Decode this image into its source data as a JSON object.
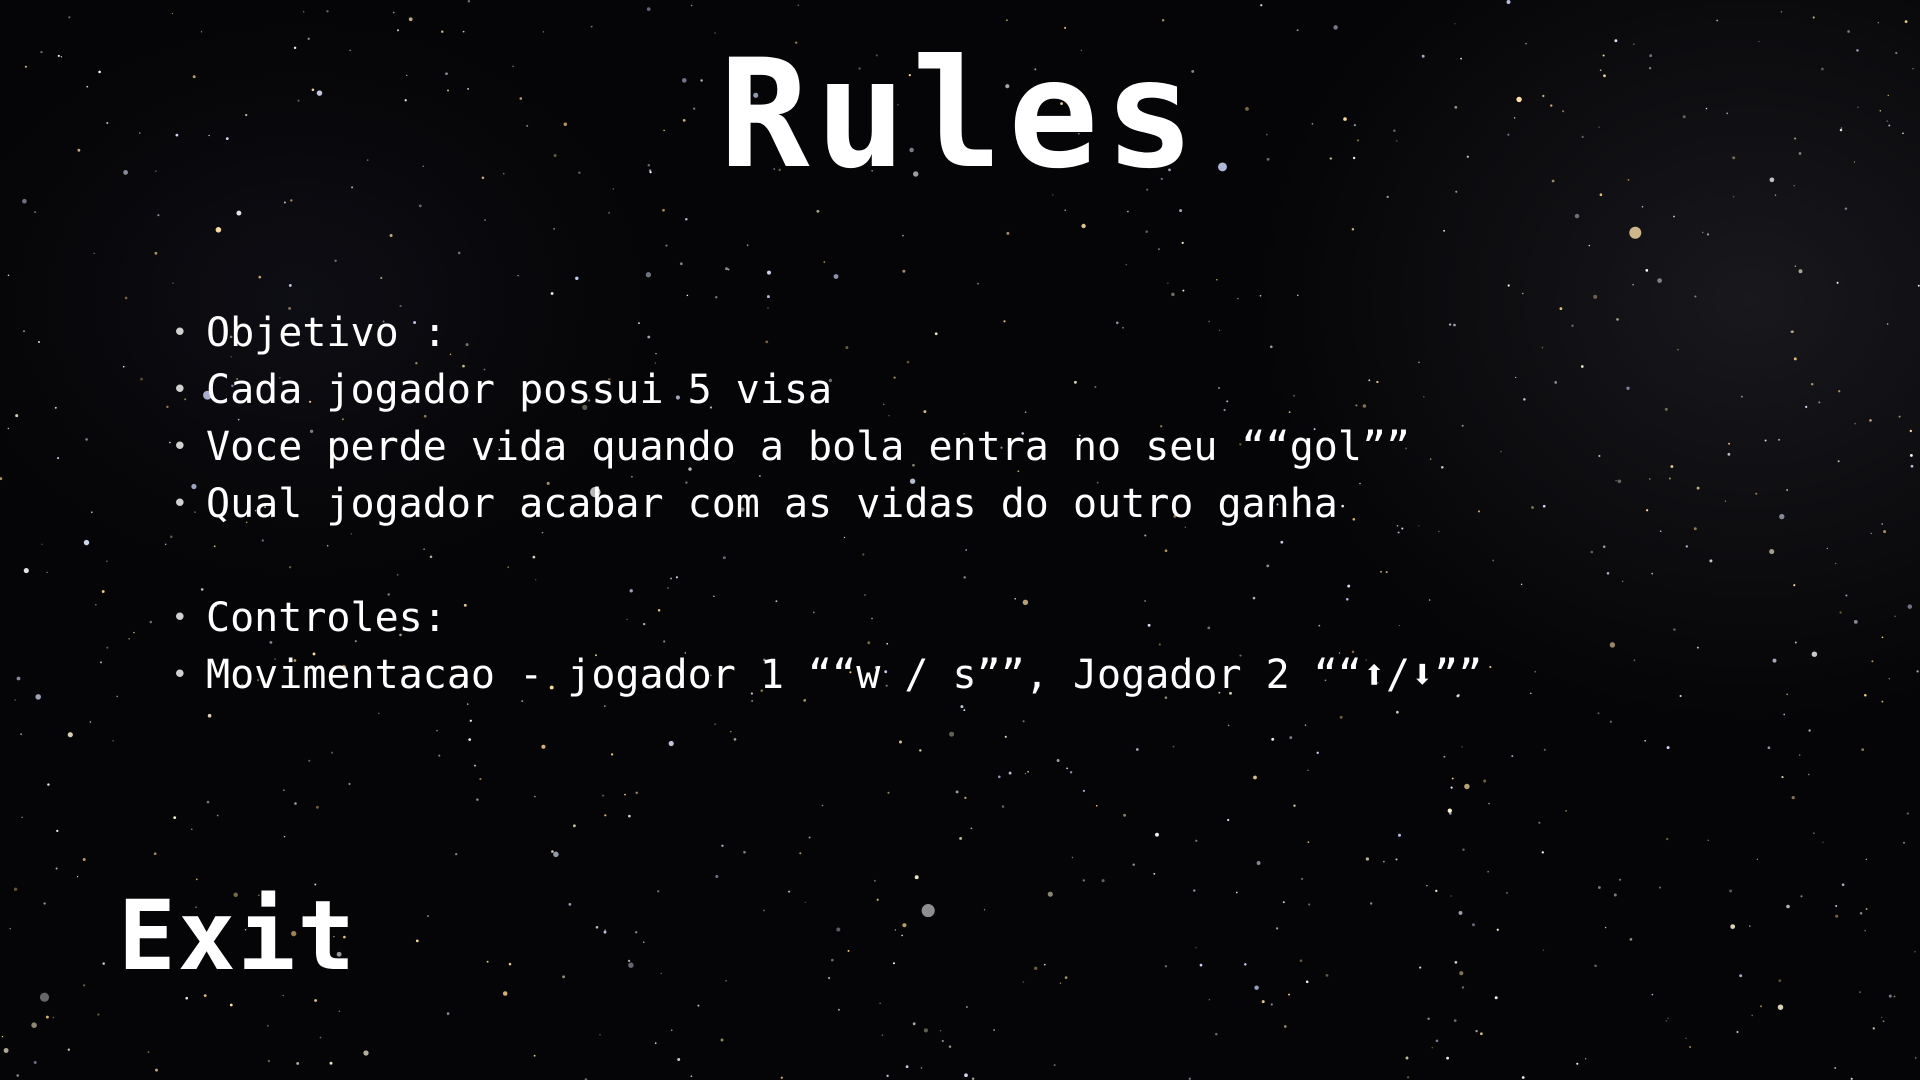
{
  "screen": {
    "title": "Rules",
    "rules": [
      "Objetivo :",
      "Cada jogador possui 5 visa",
      "Voce perde vida quando a bola entra no seu ““gol””",
      "Qual jogador acabar com as vidas do outro ganha"
    ],
    "controls": [
      "Controles:",
      "Movimentacao - jogador 1 ““w / s””, Jogador 2 ““⬆/⬇””"
    ],
    "exit_label": "Exit"
  },
  "colors": {
    "background": "#050507",
    "text": "#ffffff"
  }
}
